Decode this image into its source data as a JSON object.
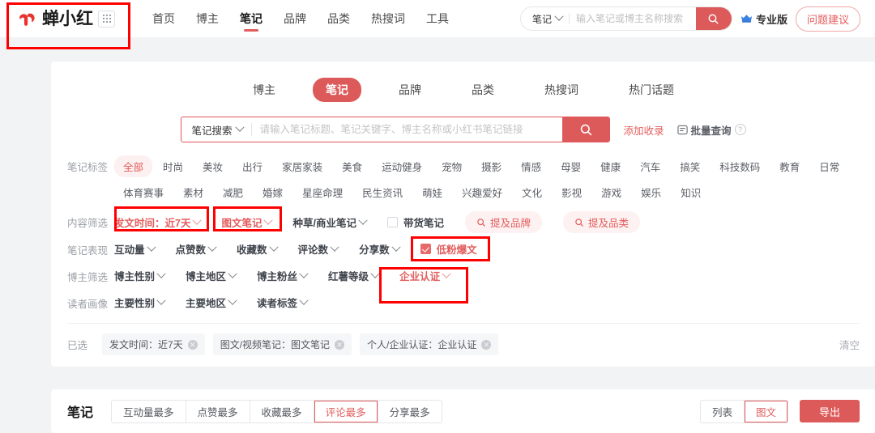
{
  "brand": {
    "name": "蝉小红",
    "logo_icon": "cicada-logo-icon",
    "grid_icon": "grid-apps-icon"
  },
  "topnav": {
    "items": [
      {
        "label": "首页",
        "active": false
      },
      {
        "label": "博主",
        "active": false
      },
      {
        "label": "笔记",
        "active": true
      },
      {
        "label": "品牌",
        "active": false
      },
      {
        "label": "品类",
        "active": false
      },
      {
        "label": "热搜词",
        "active": false
      },
      {
        "label": "工具",
        "active": false
      }
    ],
    "search": {
      "type_label": "笔记",
      "placeholder": "输入笔记或博主名称搜索",
      "value": "",
      "button_icon": "search-icon"
    },
    "pro_label": "专业版",
    "pro_icon": "crown-badge-icon",
    "feedback_label": "问题建议"
  },
  "subtabs": [
    {
      "label": "博主",
      "active": false
    },
    {
      "label": "笔记",
      "active": true
    },
    {
      "label": "品牌",
      "active": false
    },
    {
      "label": "品类",
      "active": false
    },
    {
      "label": "热搜词",
      "active": false
    },
    {
      "label": "热门话题",
      "active": false
    }
  ],
  "search_panel": {
    "type_label": "笔记搜索",
    "placeholder": "请输入笔记标题、笔记关键字、博主名称或小红书笔记链接",
    "value": "",
    "button_icon": "search-icon",
    "add_record_label": "添加收录",
    "batch_query_label": "批量查询",
    "batch_query_icon": "batch-query-icon",
    "help_icon": "question-mark-icon"
  },
  "filters": {
    "note_tags": {
      "label": "笔记标签",
      "tags": [
        {
          "label": "全部",
          "active": true
        },
        {
          "label": "时尚",
          "active": false
        },
        {
          "label": "美妆",
          "active": false
        },
        {
          "label": "出行",
          "active": false
        },
        {
          "label": "家居家装",
          "active": false
        },
        {
          "label": "美食",
          "active": false
        },
        {
          "label": "运动健身",
          "active": false
        },
        {
          "label": "宠物",
          "active": false
        },
        {
          "label": "摄影",
          "active": false
        },
        {
          "label": "情感",
          "active": false
        },
        {
          "label": "母婴",
          "active": false
        },
        {
          "label": "健康",
          "active": false
        },
        {
          "label": "汽车",
          "active": false
        },
        {
          "label": "搞笑",
          "active": false
        },
        {
          "label": "科技数码",
          "active": false
        },
        {
          "label": "教育",
          "active": false
        },
        {
          "label": "日常",
          "active": false
        },
        {
          "label": "体育赛事",
          "active": false
        },
        {
          "label": "素材",
          "active": false
        },
        {
          "label": "减肥",
          "active": false
        },
        {
          "label": "婚嫁",
          "active": false
        },
        {
          "label": "星座命理",
          "active": false
        },
        {
          "label": "民生资讯",
          "active": false
        },
        {
          "label": "萌娃",
          "active": false
        },
        {
          "label": "兴趣爱好",
          "active": false
        },
        {
          "label": "文化",
          "active": false
        },
        {
          "label": "影视",
          "active": false
        },
        {
          "label": "游戏",
          "active": false
        },
        {
          "label": "娱乐",
          "active": false
        },
        {
          "label": "知识",
          "active": false
        }
      ]
    },
    "content": {
      "label": "内容筛选",
      "post_time": "发文时间：近7天",
      "note_type": "图文笔记",
      "business_note": "种草/商业笔记",
      "goods_note": "带货笔记",
      "mention_brand": "提及品牌",
      "mention_category": "提及品类"
    },
    "performance": {
      "label": "笔记表现",
      "interaction": "互动量",
      "likes": "点赞数",
      "collects": "收藏数",
      "comments": "评论数",
      "shares": "分享数",
      "low_fan_hit": "低粉爆文"
    },
    "blogger": {
      "label": "博主筛选",
      "gender": "博主性别",
      "region": "博主地区",
      "fans": "博主粉丝",
      "level": "红薯等级",
      "enterprise_auth": "企业认证"
    },
    "audience": {
      "label": "读者画像",
      "main_gender": "主要性别",
      "main_region": "主要地区",
      "reader_tags": "读者标签"
    },
    "selected": {
      "label": "已选",
      "chips": [
        "发文时间：近7天",
        "图文/视频笔记：图文笔记",
        "个人/企业认证：企业认证"
      ],
      "clear_label": "清空"
    }
  },
  "results": {
    "title": "笔记",
    "sorts": [
      {
        "label": "互动量最多",
        "active": false
      },
      {
        "label": "点赞最多",
        "active": false
      },
      {
        "label": "收藏最多",
        "active": false
      },
      {
        "label": "评论最多",
        "active": true
      },
      {
        "label": "分享最多",
        "active": false
      }
    ],
    "views": [
      {
        "label": "列表",
        "active": false
      },
      {
        "label": "图文",
        "active": true
      }
    ],
    "export_label": "导出"
  },
  "colors": {
    "accent": "#dd5a5a",
    "accent_text": "#e35d5d",
    "annotation": "#ff0000",
    "page_bg": "#f2f3f5"
  }
}
